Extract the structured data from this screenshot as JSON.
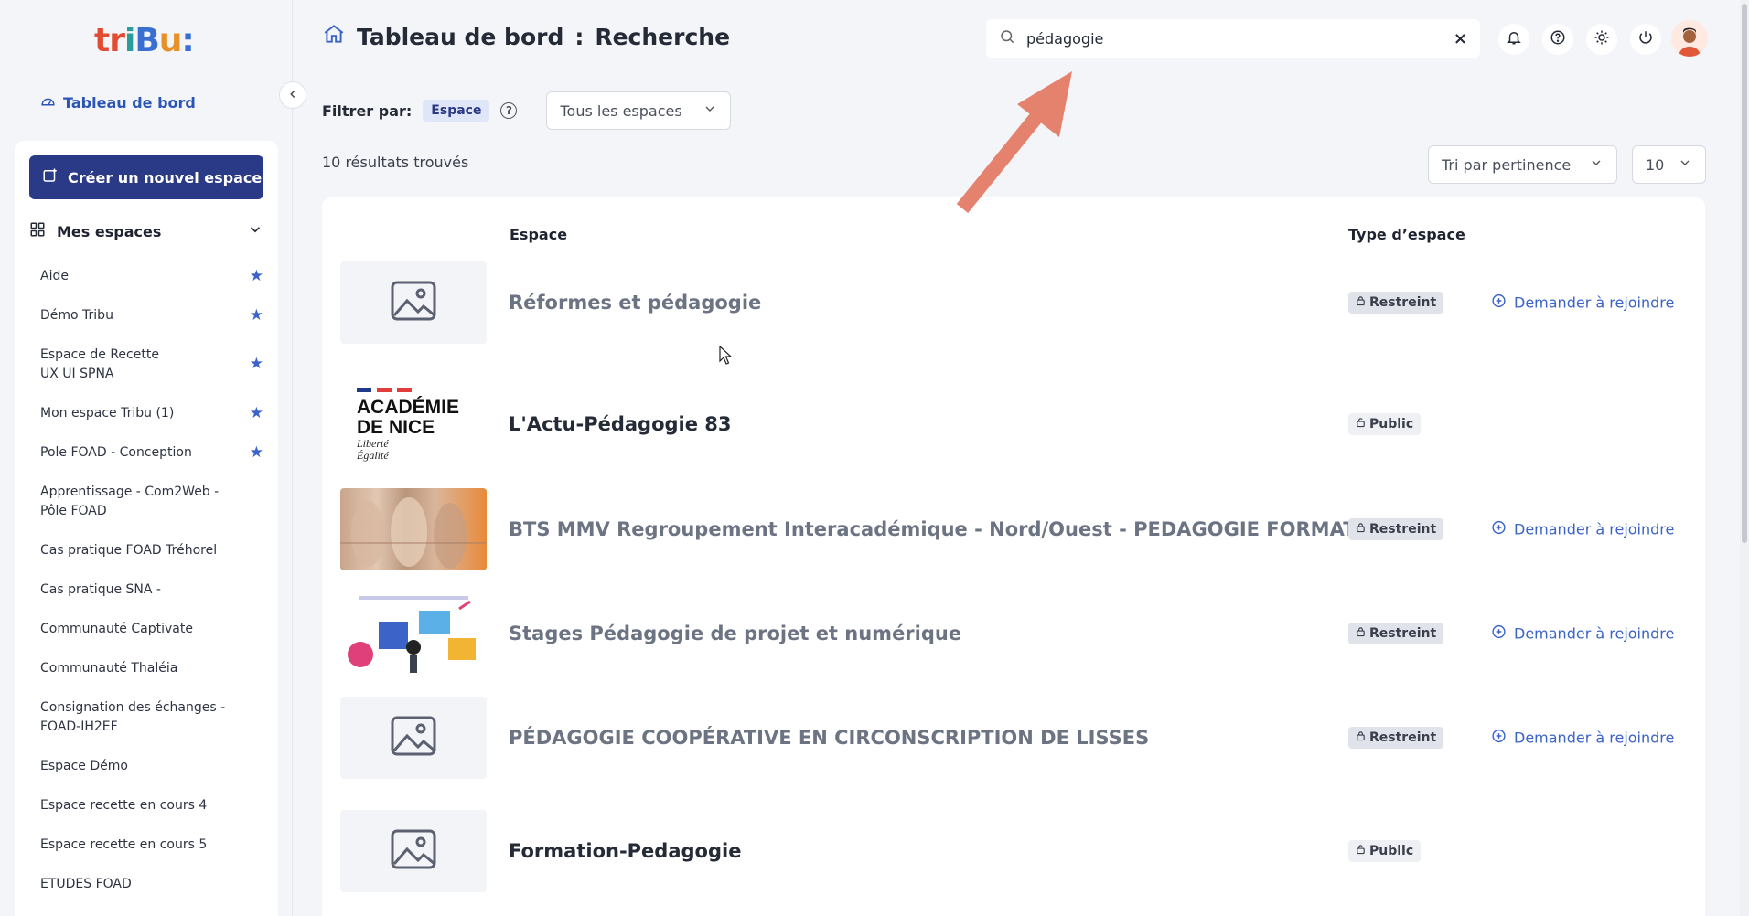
{
  "sidebar": {
    "logo": [
      "tr",
      "i",
      "B",
      "u",
      ":"
    ],
    "dashboard_link": "Tableau de bord",
    "create_button": "Créer un nouvel espace",
    "mes_espaces": "Mes espaces",
    "spaces": [
      {
        "label": "Aide",
        "starred": true
      },
      {
        "label": "Démo Tribu",
        "starred": true
      },
      {
        "label": "Espace de Recette UX UI SPNA",
        "starred": true
      },
      {
        "label": "Mon espace Tribu (1)",
        "starred": true
      },
      {
        "label": "Pole FOAD - Conception",
        "starred": true
      },
      {
        "label": "Apprentissage - Com2Web - Pôle FOAD",
        "starred": false
      },
      {
        "label": "Cas pratique FOAD Tréhorel",
        "starred": false
      },
      {
        "label": "Cas pratique SNA -",
        "starred": false
      },
      {
        "label": "Communauté Captivate",
        "starred": false
      },
      {
        "label": "Communauté Thaléia",
        "starred": false
      },
      {
        "label": "Consignation des échanges - FOAD-IH2EF",
        "starred": false
      },
      {
        "label": "Espace Démo",
        "starred": false
      },
      {
        "label": "Espace recette en cours 4",
        "starred": false
      },
      {
        "label": "Espace recette en cours 5",
        "starred": false
      },
      {
        "label": "ETUDES FOAD",
        "starred": false
      }
    ]
  },
  "header": {
    "title": "Tableau de bord",
    "separator": ":",
    "subtitle": "Recherche",
    "search_value": "pédagogie",
    "clear": "×"
  },
  "filter": {
    "label": "Filtrer par:",
    "chip": "Espace",
    "help": "?",
    "spaces_select": "Tous les espaces"
  },
  "results": {
    "count": "10 résultats trouvés",
    "sort_select": "Tri par pertinence",
    "page_size": "10",
    "col_space": "Espace",
    "col_type": "Type d’espace",
    "join_label": "Demander à rejoindre",
    "rows": [
      {
        "title": "Réformes et pédagogie",
        "type": "Restreint",
        "thumb": "placeholder",
        "joinable": true,
        "muted": true
      },
      {
        "title": "L'Actu-Pédagogie 83",
        "type": "Public",
        "thumb": "academie",
        "joinable": false,
        "muted": false
      },
      {
        "title": "BTS MMV Regroupement Interacadémique - Nord/Ouest - PEDAGOGIE FORMATION",
        "type": "Restreint",
        "thumb": "photo-mannequins",
        "joinable": true,
        "muted": true
      },
      {
        "title": "Stages Pédagogie de projet et numérique",
        "type": "Restreint",
        "thumb": "illustration",
        "joinable": true,
        "muted": true
      },
      {
        "title": "PÉDAGOGIE COOPÉRATIVE EN CIRCONSCRIPTION DE LISSES",
        "type": "Restreint",
        "thumb": "placeholder",
        "joinable": true,
        "muted": true
      },
      {
        "title": "Formation-Pedagogie",
        "type": "Public",
        "thumb": "placeholder",
        "joinable": false,
        "muted": false
      }
    ]
  },
  "academie_logo": {
    "line1": "ACADÉMIE",
    "line2": "DE NICE",
    "line3": "Liberté",
    "line4": "Égalité"
  },
  "colors": {
    "primary": "#2b3a86",
    "link": "#3b63c8",
    "annotation": "#e5826e"
  }
}
